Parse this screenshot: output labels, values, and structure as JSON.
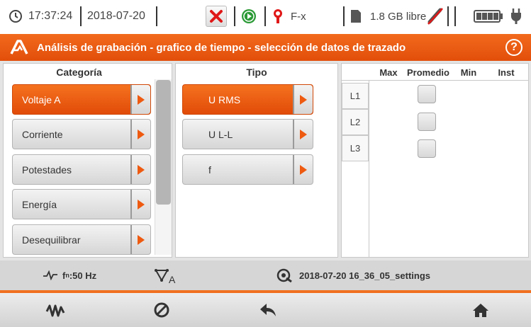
{
  "status": {
    "time": "17:37:24",
    "date": "2018-07-20",
    "clamp_label": "F-x",
    "memory": "1.8 GB libre",
    "icons": [
      "clock-icon",
      "cancel-recording-icon",
      "play-icon",
      "clamp-icon",
      "sd-card-icon",
      "usb-icon",
      "battery-icon",
      "power-plug-icon"
    ]
  },
  "header": {
    "title": "Análisis de grabación - grafico de tiempo - selección de datos de trazado",
    "help": "?"
  },
  "categoria": {
    "heading": "Categoría",
    "items": [
      "Voltaje A",
      "Corriente",
      "Potestades",
      "Energía",
      "Desequilibrar"
    ],
    "selected_index": 0
  },
  "tipo": {
    "heading": "Tipo",
    "items": [
      "U RMS",
      "U L-L",
      "f"
    ],
    "selected_index": 0
  },
  "table": {
    "columns": [
      "Max",
      "Promedio",
      "Min",
      "Inst"
    ],
    "rows": [
      "L1",
      "L2",
      "L3"
    ],
    "checked": [
      [
        false
      ],
      [
        false
      ],
      [
        false
      ]
    ]
  },
  "info": {
    "frequency_prefix": "f",
    "frequency_sub": "n",
    "frequency_value": ":50 Hz",
    "config_sub": "A",
    "settings_name": "2018-07-20 16_36_05_settings"
  },
  "colors": {
    "accent": "#f26a1d",
    "status_bar": "#ffffff",
    "panel_bg": "#e4e4e4"
  }
}
